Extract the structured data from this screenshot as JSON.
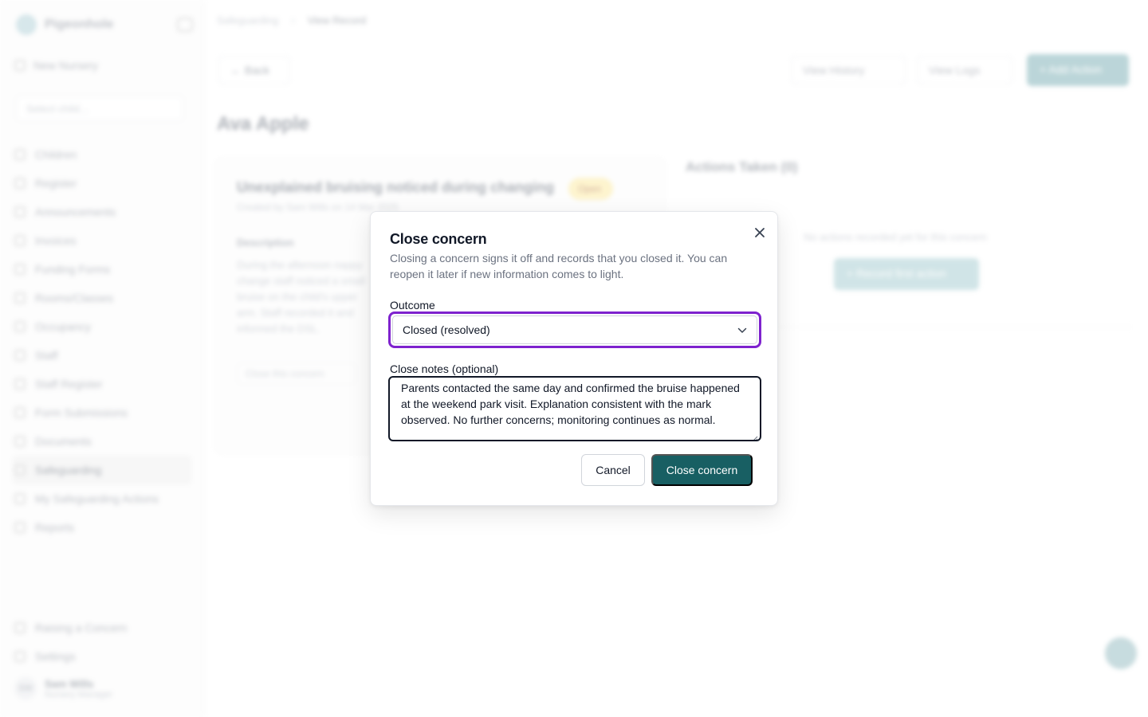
{
  "app": {
    "logo_text": "Pigeonhole",
    "new_setting": "New Nursery",
    "child_select_placeholder": "Select child...",
    "nav": [
      {
        "label": "Children",
        "icon": "children-icon"
      },
      {
        "label": "Register",
        "icon": "register-icon"
      },
      {
        "label": "Announcements",
        "icon": "megaphone-icon"
      },
      {
        "label": "Invoices",
        "icon": "invoice-icon"
      },
      {
        "label": "Funding Forms",
        "icon": "funding-icon"
      },
      {
        "label": "Rooms/Classes",
        "icon": "rooms-icon"
      },
      {
        "label": "Occupancy",
        "icon": "occupancy-icon"
      },
      {
        "label": "Staff",
        "icon": "staff-icon"
      },
      {
        "label": "Staff Register",
        "icon": "staff-register-icon"
      },
      {
        "label": "Form Submissions",
        "icon": "forms-icon"
      },
      {
        "label": "Documents",
        "icon": "documents-icon"
      },
      {
        "label": "Safeguarding",
        "icon": "shield-icon"
      },
      {
        "label": "My Safeguarding Actions",
        "icon": "actions-icon"
      },
      {
        "label": "Reports",
        "icon": "reports-icon"
      }
    ],
    "nav_active_index": 11,
    "nav_bottom": [
      {
        "label": "Raising a Concern",
        "icon": "flag-icon"
      },
      {
        "label": "Settings",
        "icon": "gear-icon"
      }
    ],
    "user": {
      "initials": "SW",
      "name": "Sam Wills",
      "subtitle": "Nursery Manager"
    }
  },
  "page": {
    "breadcrumb": [
      "Safeguarding",
      "View Record"
    ],
    "back_label": "Back",
    "view_history_label": "View History",
    "view_logs_label": "View Logs",
    "add_action_label": "Add Action",
    "child_name": "Ava Apple",
    "concern": {
      "title": "Unexplained bruising noticed during changing",
      "status": "Open",
      "meta": "Created by Sam Wills on 14 Mar 2025",
      "description_heading": "Description",
      "description": "During the afternoon nappy change staff noticed a small bruise on the child's upper arm. Staff recorded it and informed the DSL.",
      "close_button": "Close this concern"
    },
    "actions": {
      "heading": "Actions Taken (0)",
      "empty_text": "No actions recorded yet for this concern",
      "record_first_label": "Record first action"
    }
  },
  "modal": {
    "title": "Close concern",
    "description": "Closing a concern signs it off and records that you closed it. You can reopen it later if new information comes to light.",
    "outcome_label": "Outcome",
    "outcome_value": "Closed (resolved)",
    "notes_label": "Close notes (optional)",
    "notes_value": "Parents contacted the same day and confirmed the bruise happened at the weekend park visit. Explanation consistent with the mark observed. No further concerns; monitoring continues as normal.",
    "cancel_label": "Cancel",
    "confirm_label": "Close concern"
  },
  "colors": {
    "accent": "#185f63",
    "focus_ring": "#7e22ce",
    "status_badge": "#fde68a"
  }
}
